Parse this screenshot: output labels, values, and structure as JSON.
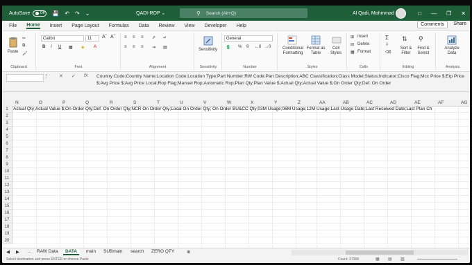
{
  "titlebar": {
    "autosave_label": "AutoSave",
    "autosave_state": "Off",
    "document_title": "QADI-ROP ⌄",
    "search_placeholder": "Search (Alt+Q)",
    "user_name": "Al Qadi, Mohmmad",
    "accent_color": "#1e5e38"
  },
  "menu": {
    "tabs": [
      "File",
      "Home",
      "Insert",
      "Page Layout",
      "Formulas",
      "Data",
      "Review",
      "View",
      "Developer",
      "Help"
    ],
    "active_tab": "Home",
    "comments_label": "Comments",
    "share_label": "Share"
  },
  "ribbon": {
    "clipboard": {
      "paste": "Paste",
      "label": "Clipboard"
    },
    "font": {
      "name": "Calibri",
      "size": "11",
      "label": "Font"
    },
    "alignment": {
      "label": "Alignment"
    },
    "sensitivity": {
      "button": "Sensitivity",
      "label": "Sensitivity"
    },
    "number": {
      "format": "General",
      "label": "Number"
    },
    "styles": {
      "conditional": "Conditional Formatting",
      "format_table": "Format as Table",
      "cell_styles": "Cell Styles",
      "label": "Styles"
    },
    "cells": {
      "insert": "Insert",
      "delete": "Delete",
      "format": "Format",
      "label": "Cells"
    },
    "editing": {
      "sort": "Sort & Filter",
      "find": "Find & Select",
      "label": "Editing"
    },
    "analysis": {
      "analyze": "Analyze Data",
      "label": "Analysis"
    }
  },
  "formula": {
    "text": "Country Code;Country Name;Location Code;Location Type;Part Number;RW Code;Part Description;ABC Classification;Class Model;Status;Indicator;Cisco Flag;Mcc Price $;Etp Price $;Avg Price $;Avg Price Local;Rop Flag;Manuel Rop;Automatic Rop;Plan Qty;Plan Value $;Actual Qty;Actual Value $;On Order Qty;Def. On Order"
  },
  "grid": {
    "columns": [
      "N",
      "O",
      "P",
      "Q",
      "R",
      "S",
      "T",
      "U",
      "V",
      "W",
      "X",
      "Y",
      "Z",
      "AA",
      "AB",
      "AC",
      "AD",
      "AE",
      "AF",
      "AG"
    ],
    "rows": [
      "1",
      "2",
      "3",
      "4",
      "5",
      "6",
      "7",
      "8",
      "9",
      "10",
      "11",
      "12",
      "13",
      "14",
      "15",
      "16",
      "17",
      "18",
      "19",
      "20"
    ],
    "row1_text": "Actual Qty;Actual Value $;On Order Qty;Def. On Order Qty;NCR On Order Qty;Local On Order Qty; On Order BU&CC Qty;03M Usage;06M Usage;12M Usage;Last Usage Date;Last Received Date;Last Plan Ch"
  },
  "sheets": {
    "tabs": [
      "RAW Data",
      "DATA",
      "main",
      "SUBmain",
      "search",
      "ZERO QTY"
    ],
    "active": "DATA"
  },
  "status": {
    "message": "Select destination and press ENTER or choose Paste",
    "count": "Count: 37368"
  }
}
